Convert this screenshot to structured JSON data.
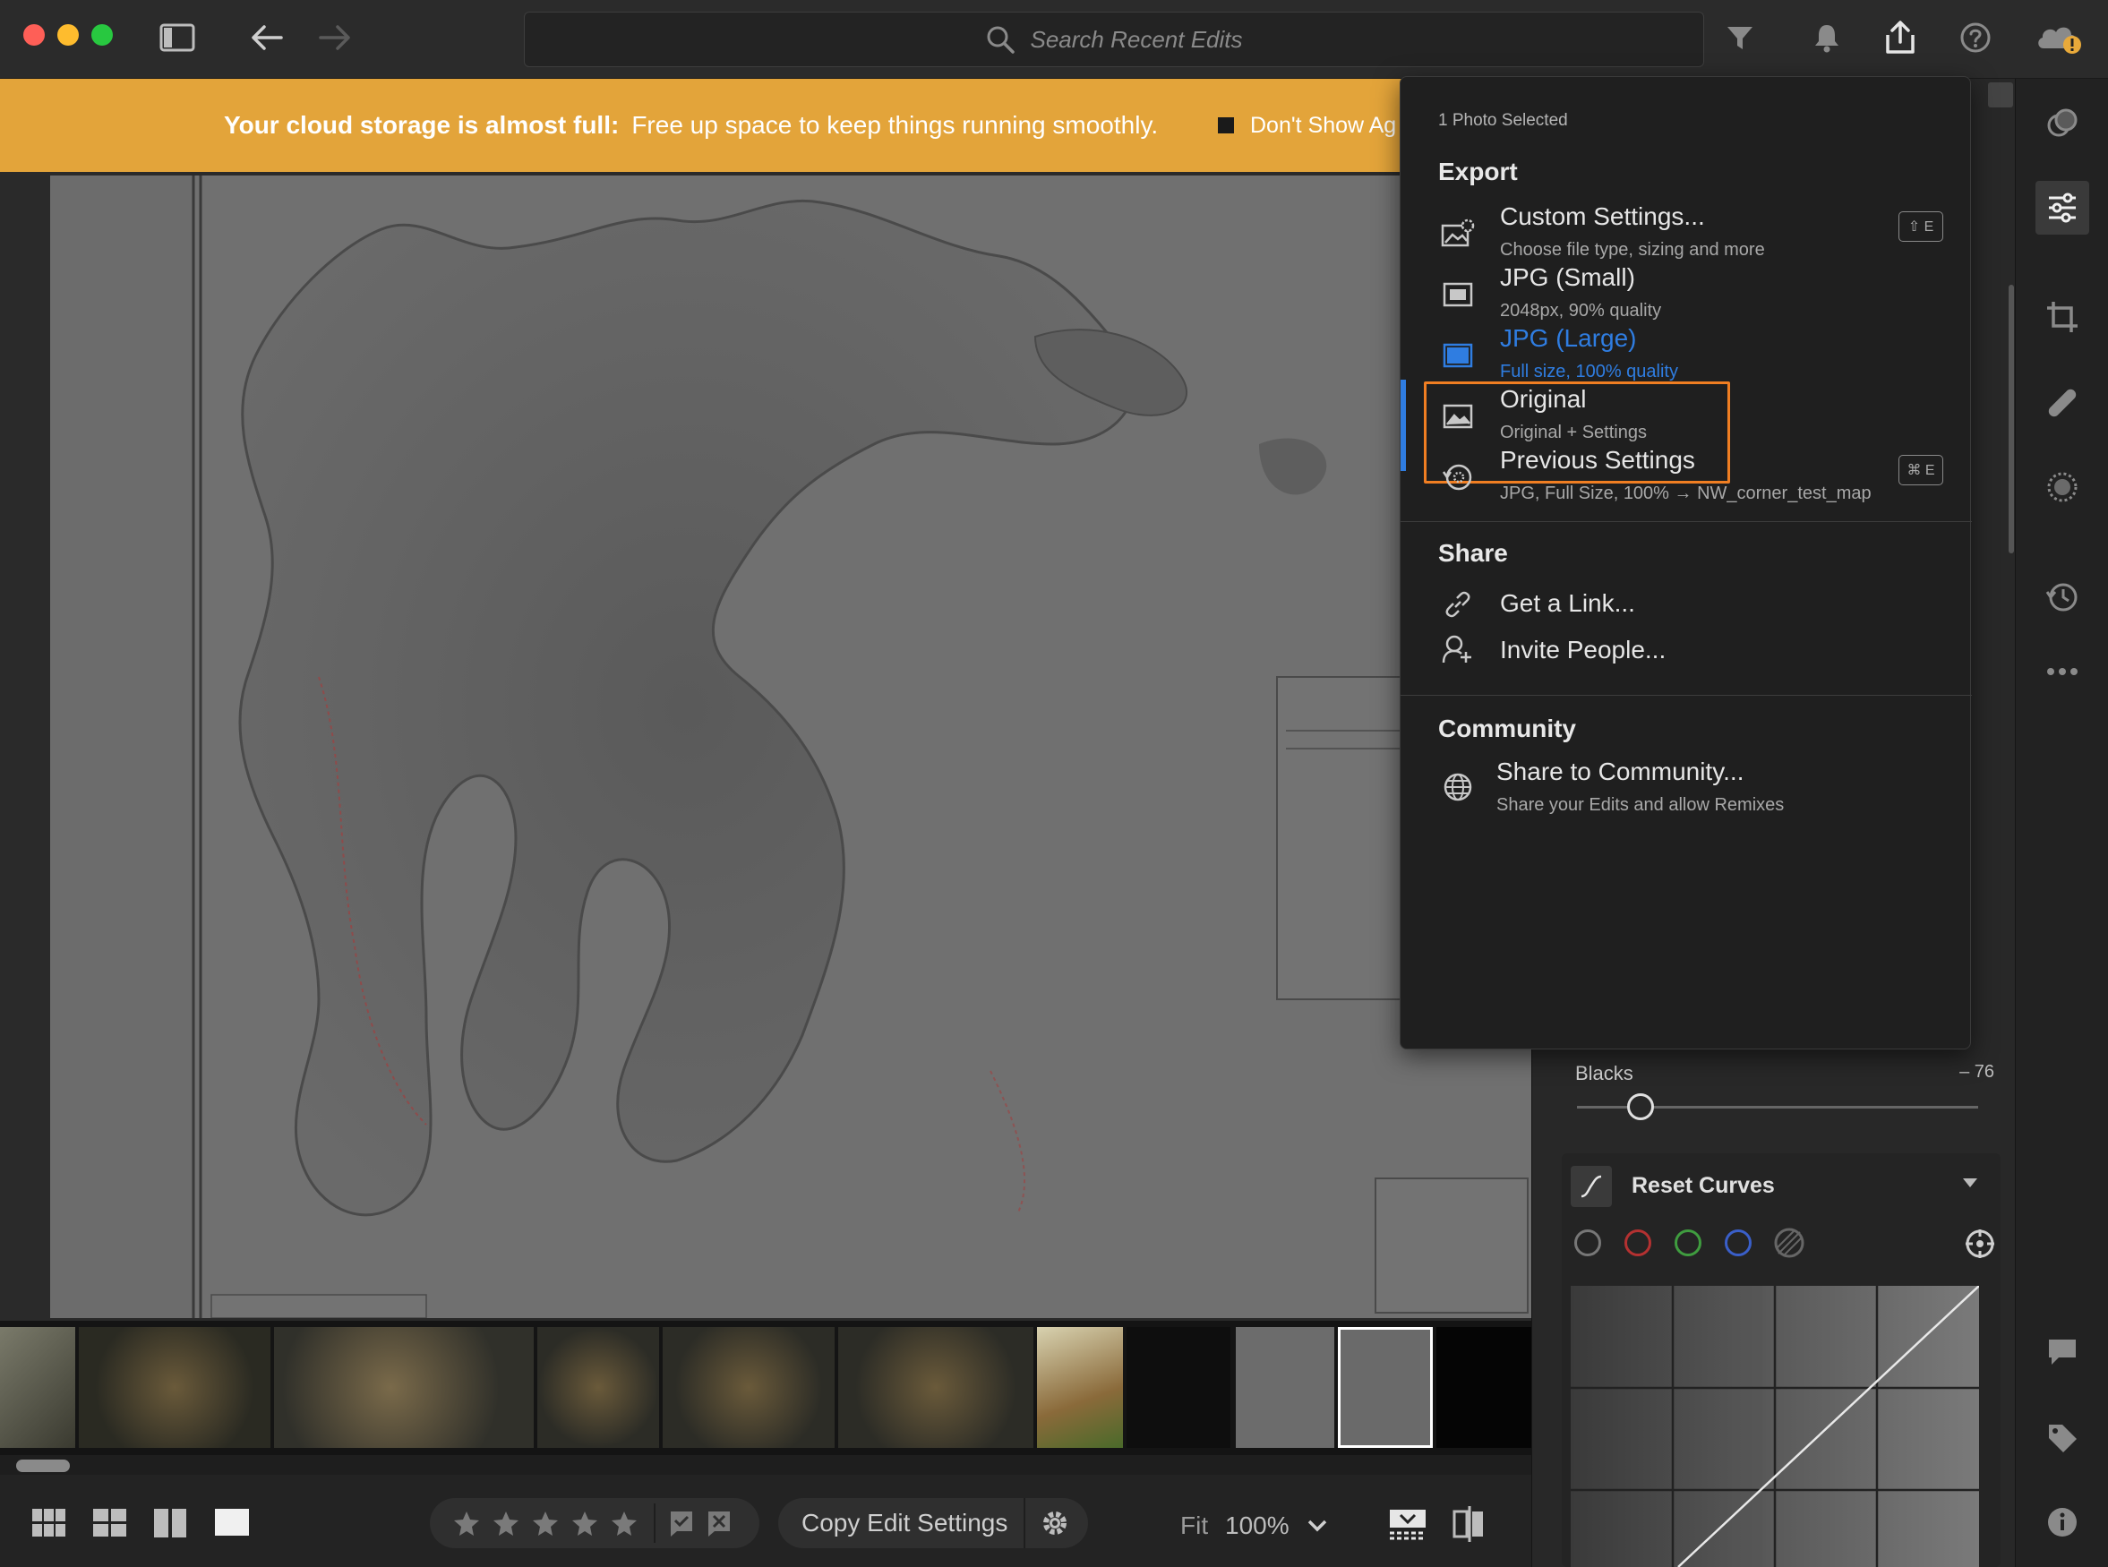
{
  "titlebar": {
    "search_placeholder": "Search Recent Edits"
  },
  "banner": {
    "title": "Your cloud storage is almost full:",
    "message": "Free up space to keep things running smoothly.",
    "dont_show": "Don't Show Ag"
  },
  "export_menu": {
    "selected_count": "1 Photo Selected",
    "export_heading": "Export",
    "items": [
      {
        "title": "Custom Settings...",
        "sub": "Choose file type, sizing and more",
        "shortcut": "⇧ E"
      },
      {
        "title": "JPG (Small)",
        "sub": "2048px, 90% quality"
      },
      {
        "title": "JPG (Large)",
        "sub": "Full size, 100% quality"
      },
      {
        "title": "Original",
        "sub": "Original + Settings"
      },
      {
        "title": "Previous Settings",
        "sub": "JPG, Full Size, 100% → NW_corner_test_map",
        "shortcut": "⌘ E"
      }
    ],
    "share_heading": "Share",
    "share_items": [
      "Get a Link...",
      "Invite People..."
    ],
    "community_heading": "Community",
    "community_item": {
      "title": "Share to Community...",
      "sub": "Share your Edits and allow Remixes"
    }
  },
  "edit_panel": {
    "blacks_label": "Blacks",
    "blacks_value": "– 76",
    "blacks_level": -76,
    "curves_label": "Reset Curves"
  },
  "bottom_toolbar": {
    "copy_edit": "Copy Edit Settings",
    "fit": "Fit",
    "zoom": "100%"
  },
  "colors": {
    "accent_blue": "#2f7de1",
    "highlight_orange": "#f07e22",
    "banner_yellow": "#e3a43a"
  }
}
